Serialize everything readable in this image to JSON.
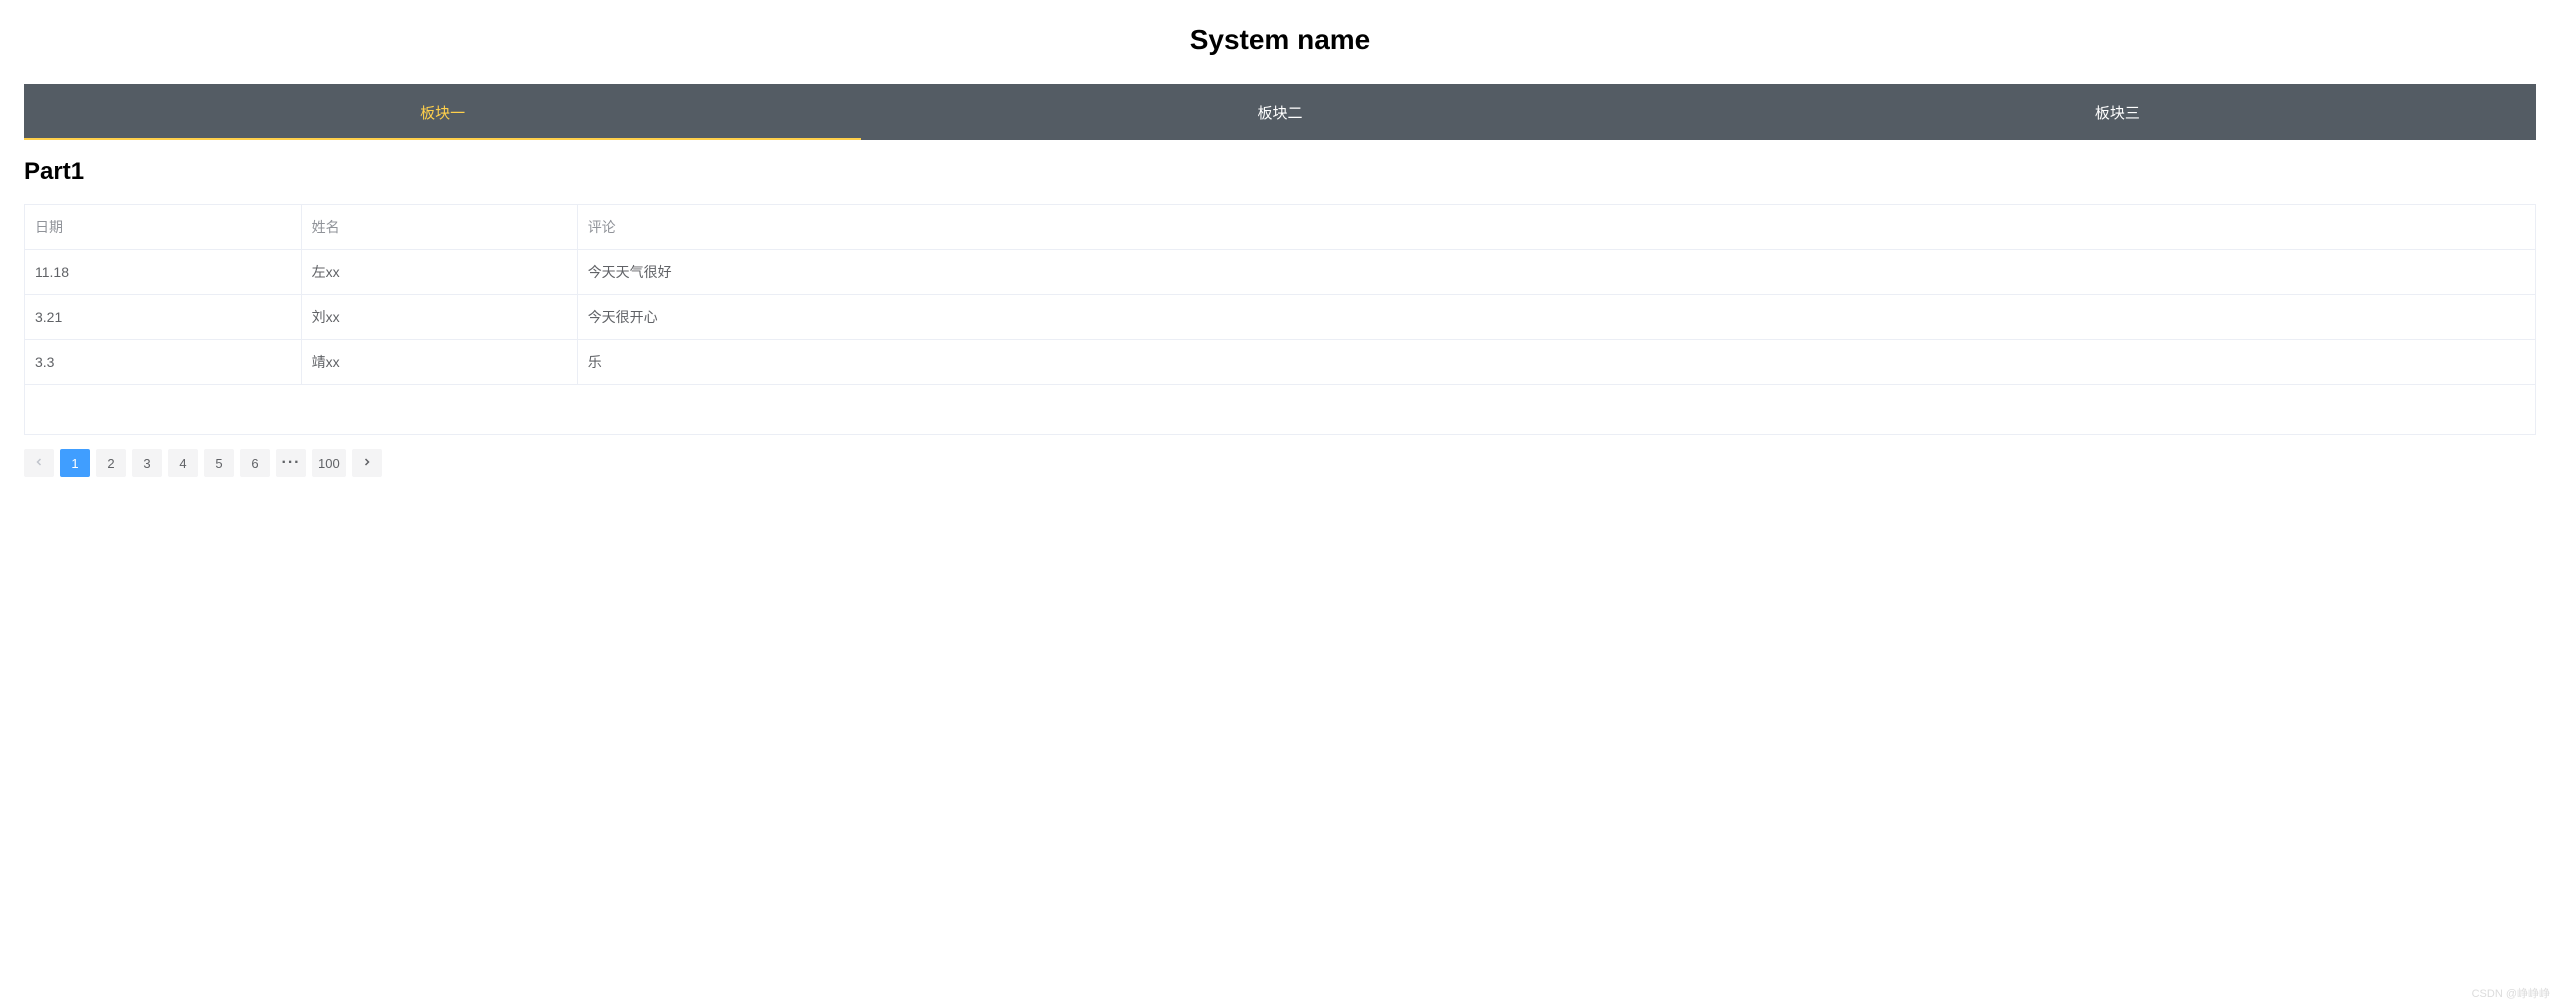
{
  "header": {
    "title": "System name"
  },
  "tabs": [
    {
      "label": "板块一",
      "active": true
    },
    {
      "label": "板块二",
      "active": false
    },
    {
      "label": "板块三",
      "active": false
    }
  ],
  "section": {
    "title": "Part1"
  },
  "table": {
    "headers": {
      "date": "日期",
      "name": "姓名",
      "comment": "评论"
    },
    "rows": [
      {
        "date": "11.18",
        "name": "左xx",
        "comment": "今天天气很好"
      },
      {
        "date": "3.21",
        "name": "刘xx",
        "comment": "今天很开心"
      },
      {
        "date": "3.3",
        "name": "靖xx",
        "comment": "乐"
      }
    ]
  },
  "pagination": {
    "pages": [
      "1",
      "2",
      "3",
      "4",
      "5",
      "6"
    ],
    "ellipsis": "···",
    "last": "100",
    "current": "1"
  },
  "watermark": "CSDN @峥峥峥"
}
